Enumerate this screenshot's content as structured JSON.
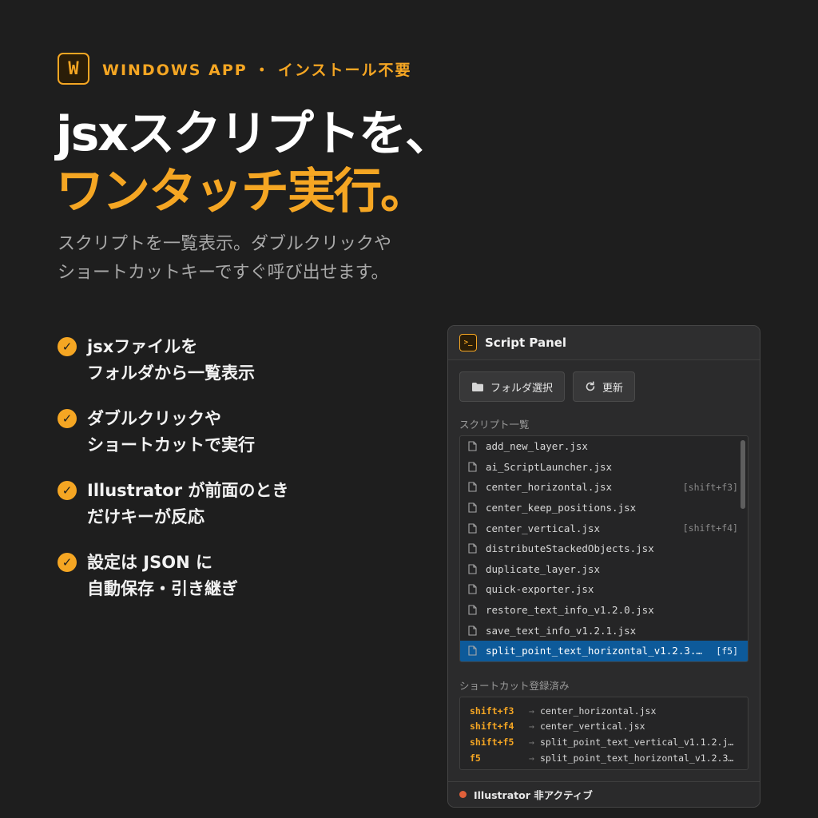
{
  "brand": {
    "logo_letter": "W",
    "badge": "WINDOWS APP ・ インストール不要",
    "accent_color": "#f5a623"
  },
  "hero": {
    "title_line1": "jsxスクリプトを、",
    "title_line2": "ワンタッチ実行。",
    "subtitle_line1": "スクリプトを一覧表示。ダブルクリックや",
    "subtitle_line2": "ショートカットキーですぐ呼び出せます。"
  },
  "features": [
    {
      "line1": "jsxファイルを",
      "line2": "フォルダから一覧表示",
      "icon": "check-icon"
    },
    {
      "line1": "ダブルクリックや",
      "line2": "ショートカットで実行",
      "icon": "check-icon"
    },
    {
      "line1": "Illustrator が前面のとき",
      "line2": "だけキーが反応",
      "icon": "check-icon"
    },
    {
      "line1": "設定は JSON に",
      "line2": "自動保存・引き継ぎ",
      "icon": "check-icon"
    }
  ],
  "panel": {
    "icon_glyph": ">_",
    "title": "Script Panel",
    "toolbar": {
      "folder_label": "フォルダ選択",
      "folder_icon": "folder-icon",
      "refresh_label": "更新",
      "refresh_icon": "refresh-icon"
    },
    "list_label": "スクリプト一覧",
    "scripts": [
      {
        "name": "add_new_layer.jsx",
        "shortcut": ""
      },
      {
        "name": "ai_ScriptLauncher.jsx",
        "shortcut": ""
      },
      {
        "name": "center_horizontal.jsx",
        "shortcut": "[shift+f3]"
      },
      {
        "name": "center_keep_positions.jsx",
        "shortcut": ""
      },
      {
        "name": "center_vertical.jsx",
        "shortcut": "[shift+f4]"
      },
      {
        "name": "distributeStackedObjects.jsx",
        "shortcut": ""
      },
      {
        "name": "duplicate_layer.jsx",
        "shortcut": ""
      },
      {
        "name": "quick-exporter.jsx",
        "shortcut": ""
      },
      {
        "name": "restore_text_info_v1.2.0.jsx",
        "shortcut": ""
      },
      {
        "name": "save_text_info_v1.2.1.jsx",
        "shortcut": ""
      },
      {
        "name": "split_point_text_horizontal_v1.2.3.…",
        "shortcut": "[f5]",
        "selected": true
      }
    ],
    "shortcuts_label": "ショートカット登録済み",
    "shortcuts": [
      {
        "key": "shift+f3",
        "arrow": "→",
        "target": "center_horizontal.jsx"
      },
      {
        "key": "shift+f4",
        "arrow": "→",
        "target": "center_vertical.jsx"
      },
      {
        "key": "shift+f5",
        "arrow": "→",
        "target": "split_point_text_vertical_v1.1.2.j…"
      },
      {
        "key": "f5",
        "arrow": "→",
        "target": "split_point_text_horizontal_v1.2.3…"
      }
    ],
    "status": {
      "text": "Illustrator 非アクティブ",
      "dot_color": "#e0603a"
    }
  }
}
